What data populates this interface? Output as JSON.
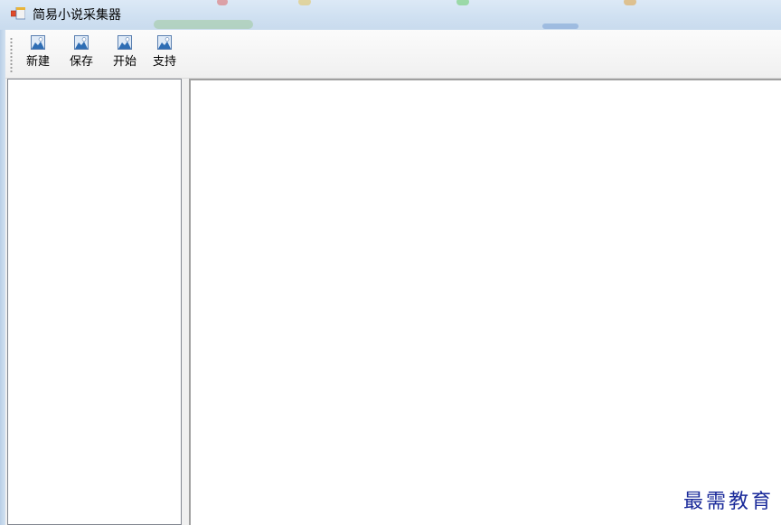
{
  "window": {
    "title": "简易小说采集器",
    "app_icon": "windows-form-icon"
  },
  "toolbar": {
    "buttons": [
      {
        "label": "新建",
        "icon": "image-placeholder-icon"
      },
      {
        "label": "保存",
        "icon": "image-placeholder-icon"
      },
      {
        "label": "开始",
        "icon": "image-placeholder-icon"
      },
      {
        "label": "支持",
        "icon": "image-placeholder-icon"
      }
    ]
  },
  "watermark": {
    "text": "最需教育"
  },
  "colors": {
    "titlebar": "#cfe0f1",
    "panel_border": "#828790",
    "watermark": "#1a2a9a"
  }
}
